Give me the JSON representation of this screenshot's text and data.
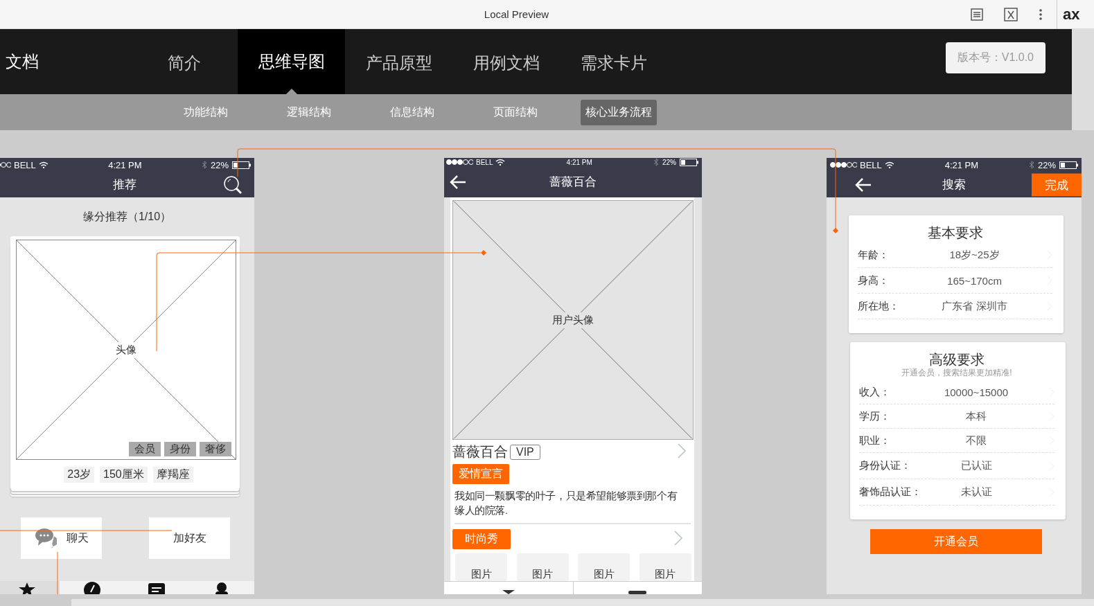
{
  "browser": {
    "title": "Local Preview",
    "logo": "ax"
  },
  "header": {
    "project": "文档",
    "version": "版本号：V1.0.0",
    "tabs": [
      {
        "label": "简介",
        "selected": false
      },
      {
        "label": "思维导图",
        "selected": true
      },
      {
        "label": "产品原型",
        "selected": false
      },
      {
        "label": "用例文档",
        "selected": false
      },
      {
        "label": "需求卡片",
        "selected": false
      }
    ]
  },
  "subnav": [
    {
      "label": "功能结构",
      "selected": false
    },
    {
      "label": "逻辑结构",
      "selected": false
    },
    {
      "label": "信息结构",
      "selected": false
    },
    {
      "label": "页面结构",
      "selected": false
    },
    {
      "label": "核心业务流程",
      "selected": true
    }
  ],
  "screens": [
    {
      "kind": "recommend",
      "status": {
        "carrier": "BELL",
        "time": "4:21 PM",
        "battery": "22%"
      },
      "title": "推荐",
      "heading": "缘分推荐（1/10）",
      "image_label": "头像",
      "badges": [
        "会员",
        "身份",
        "奢侈"
      ],
      "info": [
        "23岁",
        "150厘米",
        "摩羯座"
      ],
      "actions": [
        {
          "label": "聊天",
          "kind": "chat"
        },
        {
          "label": "加好友",
          "kind": "plain"
        }
      ]
    },
    {
      "kind": "profile",
      "status": {
        "carrier": "BELL",
        "time": "4:21 PM",
        "battery": "22%"
      },
      "title": "蔷薇百合",
      "image_label": "用户头像",
      "name": "蔷薇百合",
      "badge": "VIP",
      "tag": "爱情宣言",
      "text": "我如同一颗飘零的叶子，只是希望能够票到那个有缘人的院落.",
      "tag2": "时尚秀",
      "photos": [
        "图片",
        "图片",
        "图片",
        "图片"
      ]
    },
    {
      "kind": "search",
      "status": {
        "carrier": "BELL",
        "time": "4:21 PM",
        "battery": "22%"
      },
      "title": "搜索",
      "action": "完成",
      "sections": [
        {
          "title": "基本要求",
          "rows": [
            {
              "label": "年龄：",
              "value": "18岁~25岁"
            },
            {
              "label": "身高：",
              "value": "165~170cm"
            },
            {
              "label": "所在地：",
              "value": "广东省 深圳市"
            }
          ]
        },
        {
          "title": "高级要求",
          "subtitle": "开通会员，搜索结果更加精准!",
          "rows": [
            {
              "label": "收入：",
              "value": "10000~15000"
            },
            {
              "label": "学历：",
              "value": "本科"
            },
            {
              "label": "职业：",
              "value": "不限"
            },
            {
              "label": "身份认证：",
              "value": "已认证"
            },
            {
              "label": "奢饰品认证：",
              "value": "未认证"
            }
          ]
        }
      ],
      "button": "开通会员"
    }
  ]
}
